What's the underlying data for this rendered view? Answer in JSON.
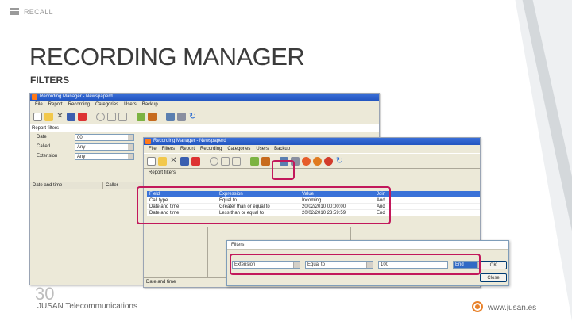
{
  "slide": {
    "brand": "RECALL",
    "title": "RECORDING MANAGER",
    "subtitle": "FILTERS",
    "slide_number": "30",
    "company": "JUSAN Telecommunications",
    "website": "www.jusan.es"
  },
  "window_back": {
    "title": "Recording Manager - Newspaperd",
    "menu": [
      "File",
      "Report",
      "Recording",
      "Categories",
      "Users",
      "Backup"
    ],
    "panel_title": "Report filters",
    "fields": [
      {
        "label": "Date",
        "value": "00"
      },
      {
        "label": "Called",
        "value": "Any"
      },
      {
        "label": "Extension",
        "value": "Any"
      }
    ],
    "grid_columns": [
      "Date and time",
      "Caller"
    ]
  },
  "window_front": {
    "title": "Recording Manager - Newspaperd",
    "menu": [
      "File",
      "Filters",
      "Report",
      "Recording",
      "Categories",
      "Users",
      "Backup"
    ],
    "panel_title": "Report filters",
    "filter_header": [
      "Field",
      "Expression",
      "Value",
      "Join"
    ],
    "filter_rows": [
      [
        "Call type",
        "Equal to",
        "Incoming",
        "And"
      ],
      [
        "Date and time",
        "Greater than or equal to",
        "20/02/2010 00:00:00",
        "And"
      ],
      [
        "Date and time",
        "Less than or equal to",
        "20/02/2010 23:59:59",
        "End"
      ]
    ],
    "bottom_columns": [
      "Date and time"
    ]
  },
  "dialog": {
    "title": "Filters",
    "field": "Extension",
    "operator": "Equal to",
    "value": "100",
    "join": "End",
    "ok_label": "OK",
    "close_label": "Close"
  },
  "colors": {
    "highlight": "#c2185b",
    "grid_header": "#3a72d8",
    "accent": "#e8812a"
  }
}
